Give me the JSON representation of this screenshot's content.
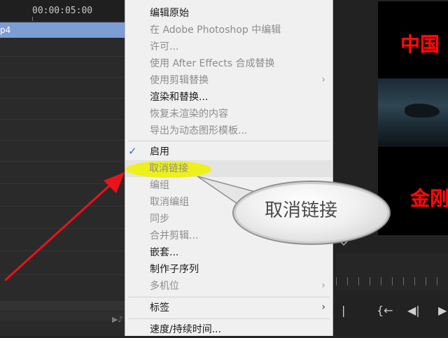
{
  "timeline": {
    "timecode": "00:00:05:00",
    "clip_name": "p4",
    "marker_icon": "▶♪"
  },
  "menu": {
    "items": [
      {
        "label": "编辑原始",
        "enabled": true
      },
      {
        "label": "在 Adobe Photoshop 中编辑",
        "enabled": false
      },
      {
        "label": "许可...",
        "enabled": false
      },
      {
        "label": "使用 After Effects 合成替换",
        "enabled": false
      },
      {
        "label": "使用剪辑替换",
        "enabled": false,
        "submenu": true
      },
      {
        "label": "渲染和替换...",
        "enabled": true
      },
      {
        "label": "恢复未渲染的内容",
        "enabled": false
      },
      {
        "label": "导出为动态图形模板...",
        "enabled": false
      },
      {
        "label": "启用",
        "enabled": true,
        "checked": true
      },
      {
        "label": "取消链接",
        "enabled": false,
        "hover": true
      },
      {
        "label": "编组",
        "enabled": false
      },
      {
        "label": "取消编组",
        "enabled": false
      },
      {
        "label": "同步",
        "enabled": false
      },
      {
        "label": "合并剪辑...",
        "enabled": false
      },
      {
        "label": "嵌套...",
        "enabled": true
      },
      {
        "label": "制作子序列",
        "enabled": true
      },
      {
        "label": "多机位",
        "enabled": false,
        "submenu": true
      },
      {
        "label": "标签",
        "enabled": true,
        "submenu": true
      },
      {
        "label": "速度/持续时间...",
        "enabled": true
      }
    ],
    "check_mark": "✓",
    "submenu_arrow": "›"
  },
  "monitor": {
    "title_top": "中国",
    "title_bottom": "金刚",
    "dropdown_icon": "chevron-down-icon",
    "controls": [
      "|",
      "{←",
      "◀|",
      "▶"
    ]
  },
  "callout": {
    "text": "取消链接"
  },
  "colors": {
    "accent_check": "#2b6fc9",
    "highlight": "#eef01a",
    "arrow": "#e8141a",
    "clip": "#7d9ed4",
    "title_red": "#ff0a0a"
  }
}
